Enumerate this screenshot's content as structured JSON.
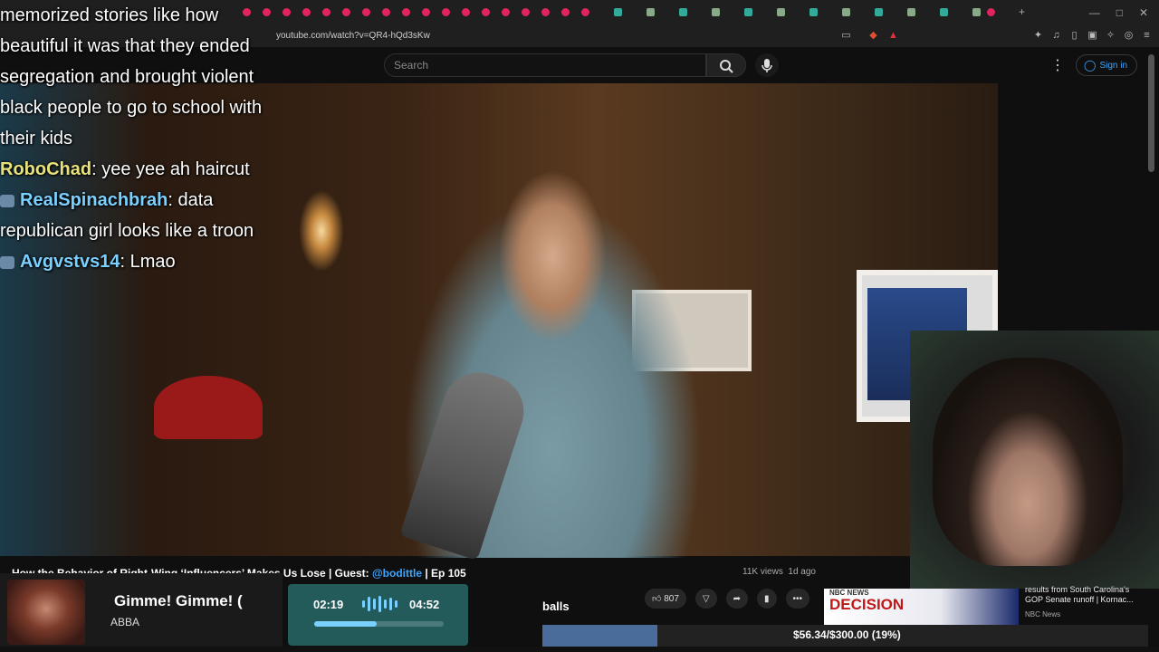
{
  "browser": {
    "url": "youtube.com/watch?v=QR4-hQd3sKw",
    "window_controls": [
      "—",
      "□",
      "✕"
    ]
  },
  "youtube": {
    "search_placeholder": "Search",
    "sign_in": "Sign in",
    "more_icon": "⋮",
    "video_title": "How the Behavior of Right-Wing ‘Influencers’ Makes Us Lose | Guest: ",
    "video_title_handle": "@bodittle",
    "video_title_suffix": " | Ep 105",
    "views": "11K views",
    "age": "1d ago",
    "likes": "807"
  },
  "chat": {
    "lines": [
      {
        "user": "",
        "text": "memorized stories like how"
      },
      {
        "user": "",
        "text": "beautiful it was that they ended"
      },
      {
        "user": "",
        "text": "segregation and brought violent"
      },
      {
        "user": "",
        "text": "black people to go to school with"
      },
      {
        "user": "",
        "text": "their kids"
      },
      {
        "user": "RoboChad",
        "text": ": yee yee ah haircut"
      },
      {
        "user": "RealSpinachbrah",
        "text": ": data"
      },
      {
        "user": "",
        "text": "republican girl looks like a troon"
      },
      {
        "user": "Avgvstvs14",
        "text": ": Lmao"
      }
    ]
  },
  "music_widget": {
    "title": "Gimme! Gimme! (",
    "artist": "ABBA",
    "current_time": "02:19",
    "total_time": "04:52",
    "progress": 0.48
  },
  "stream_overlay": {
    "label": "balls",
    "goal_text": "$56.34/$300.00 (19%)",
    "goal_fraction": 0.19
  },
  "news_card": {
    "logo": "NBC NEWS",
    "headline_graphic": "DECISION",
    "title": "results from South Carolina's GOP Senate runoff | Kornac...",
    "source": "NBC News"
  },
  "colors": {
    "accent_blue": "#3ea6ff",
    "chat_username": "#e8e27a",
    "goal_fill": "#4a6c9a",
    "music_panel": "#235a5a"
  }
}
